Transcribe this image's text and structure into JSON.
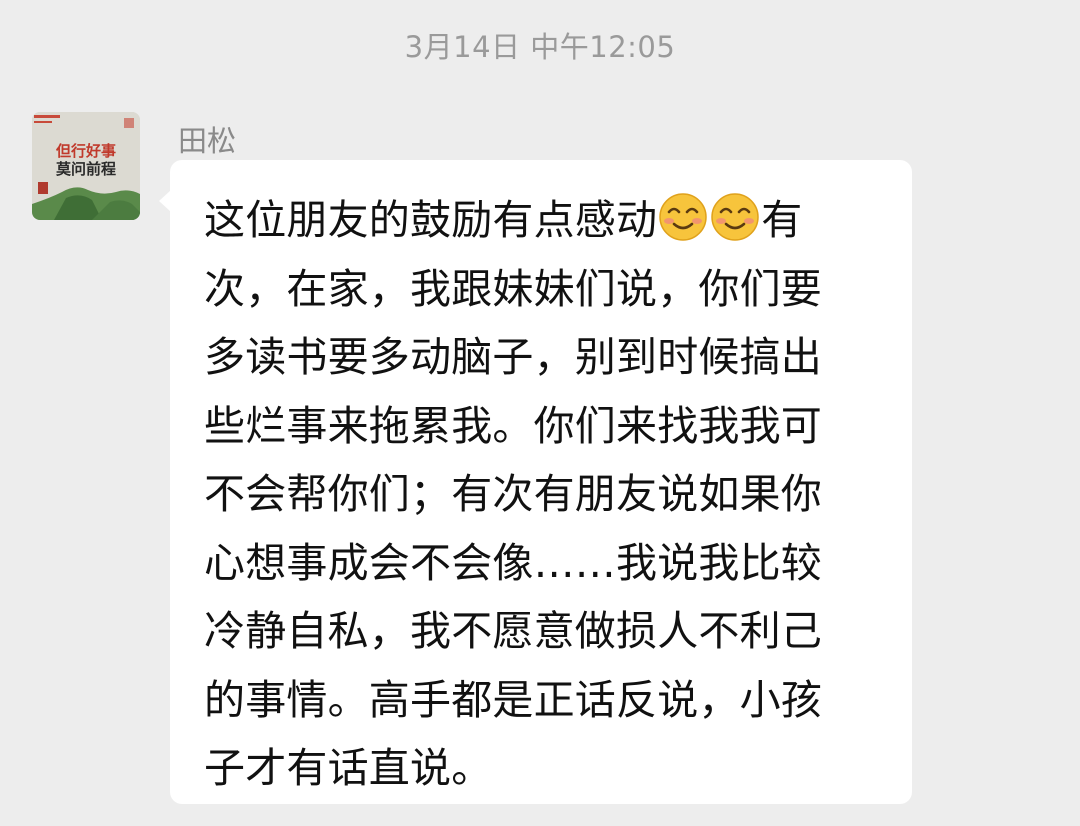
{
  "chat": {
    "timestamp": "3月14日 中午12:05",
    "message": {
      "sender_name": "田松",
      "avatar": {
        "icon": "avatar-image",
        "text_line1": "但行好事",
        "text_line2": "莫问前程"
      },
      "line1_text": "这位朋友的鼓励有点感动",
      "emoji_name": "smiling-face-icon",
      "line1_tail": "有",
      "lines": [
        "次，在家，我跟妹妹们说，你们要",
        "多读书要多动脑子，别到时候搞出",
        "些烂事来拖累我。你们来找我我可",
        "不会帮你们；有次有朋友说如果你",
        "心想事成会不会像……我说我比较",
        "冷静自私，我不愿意做损人不利己",
        "的事情。高手都是正话反说，小孩",
        "子才有话直说。"
      ]
    }
  },
  "colors": {
    "background": "#ededed",
    "bubble": "#ffffff",
    "text": "#111111",
    "meta_text": "#9a9a9a"
  }
}
